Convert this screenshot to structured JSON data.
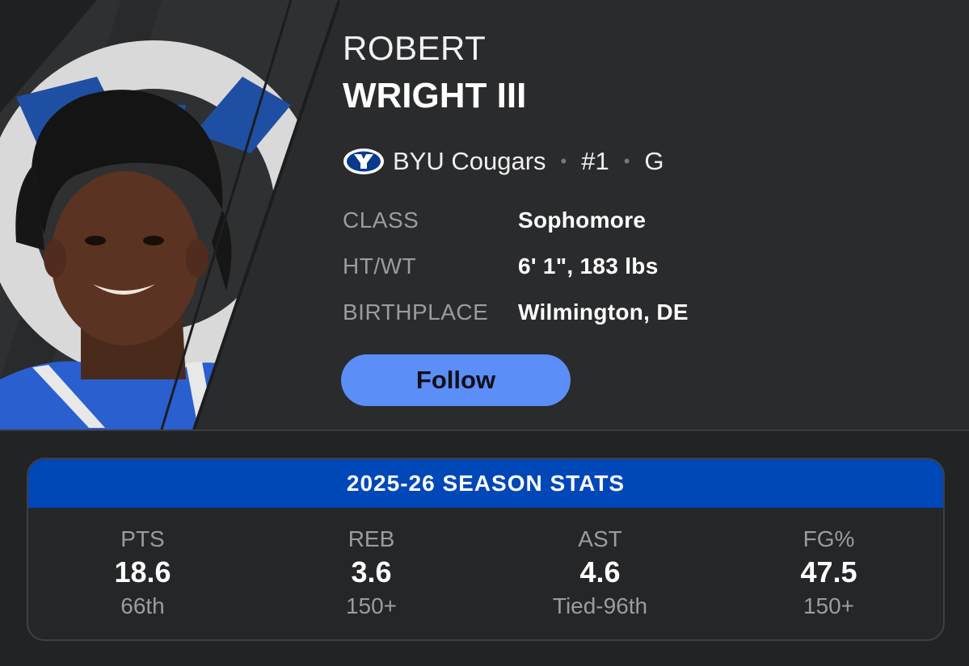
{
  "player": {
    "first_name": "ROBERT",
    "last_name": "WRIGHT III",
    "photo_icon": "player-headshot",
    "team_logo_icon": "byu-logo-icon"
  },
  "team_line": {
    "team": "BYU Cougars",
    "number": "#1",
    "position": "G",
    "separator": "•"
  },
  "info": [
    {
      "label": "CLASS",
      "value": "Sophomore"
    },
    {
      "label": "HT/WT",
      "value": "6' 1\", 183 lbs"
    },
    {
      "label": "BIRTHPLACE",
      "value": "Wilmington, DE"
    }
  ],
  "follow_label": "Follow",
  "stats": {
    "title": "2025-26 SEASON STATS",
    "columns": [
      {
        "label": "PTS",
        "value": "18.6",
        "rank": "66th"
      },
      {
        "label": "REB",
        "value": "3.6",
        "rank": "150+"
      },
      {
        "label": "AST",
        "value": "4.6",
        "rank": "Tied-96th"
      },
      {
        "label": "FG%",
        "value": "47.5",
        "rank": "150+"
      }
    ]
  },
  "colors": {
    "background": "#222325",
    "hero_background": "#2a2b2d",
    "accent_blue": "#0047b8",
    "button_blue": "#5b8ef7",
    "muted_text": "#9a9ca0"
  }
}
